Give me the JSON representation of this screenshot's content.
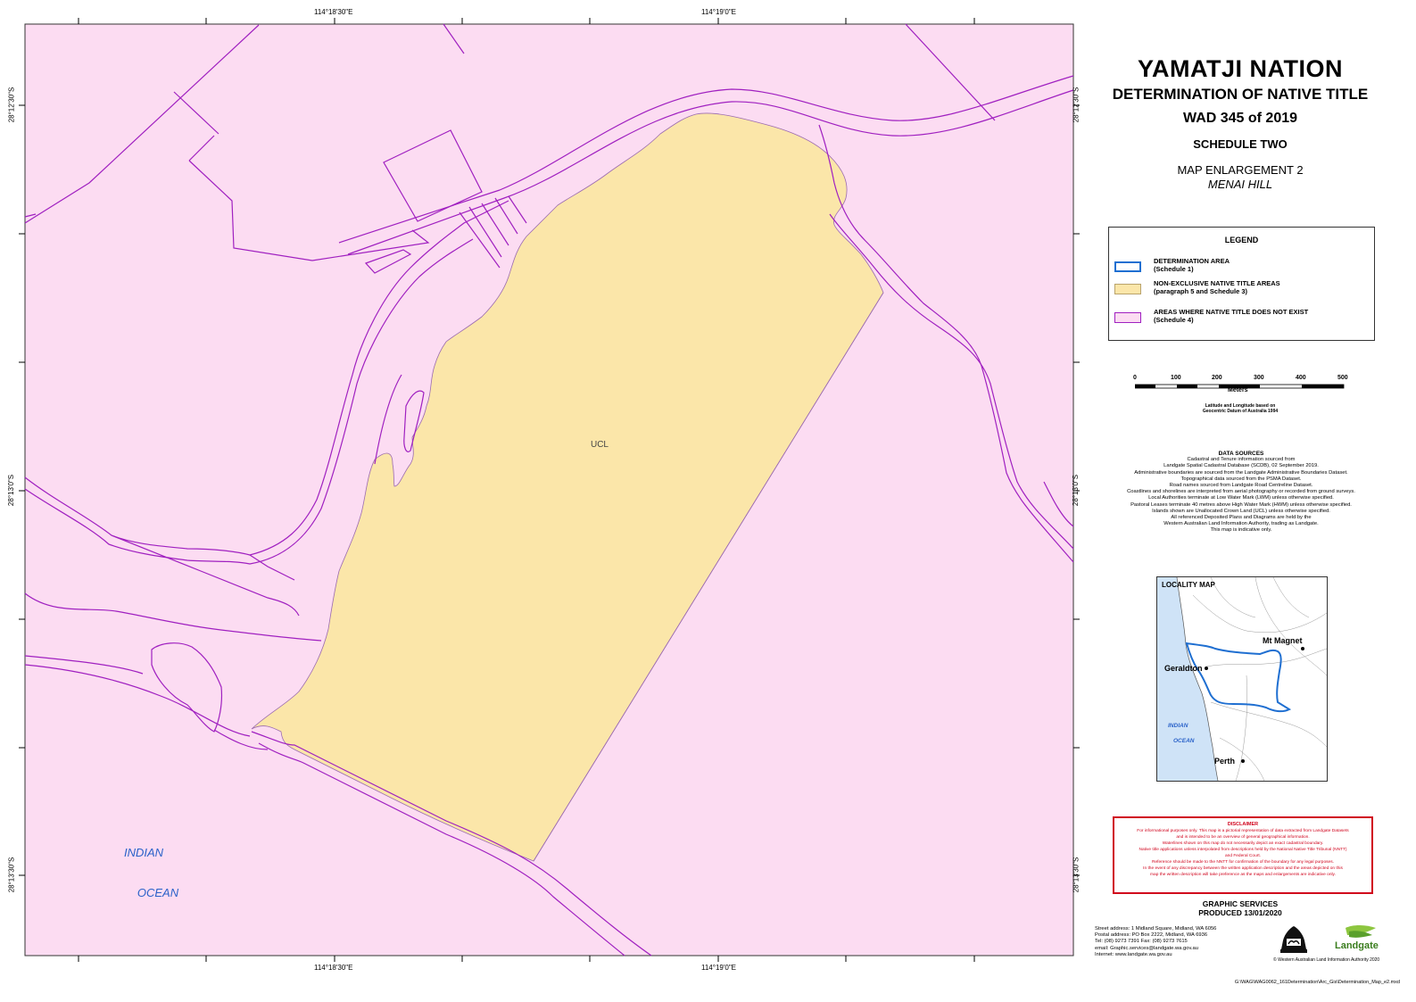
{
  "title": {
    "nation": "YAMATJI NATION",
    "determination": "DETERMINATION OF NATIVE TITLE",
    "case": "WAD 345 of 2019",
    "schedule": "SCHEDULE TWO",
    "enlargement": "MAP ENLARGEMENT 2",
    "place": "MENAI HILL"
  },
  "coordinates": {
    "top": [
      "114°18'30\"E",
      "114°19'0\"E"
    ],
    "bottom": [
      "114°18'30\"E",
      "114°19'0\"E"
    ],
    "left": [
      "28°12'30\"S",
      "28°13'0\"S",
      "28°13'30\"S"
    ],
    "right": [
      "28°12'30\"S",
      "28°13'0\"S",
      "28°13'30\"S"
    ]
  },
  "map_labels": {
    "ucl": "UCL",
    "ocean_1": "INDIAN",
    "ocean_2": "OCEAN"
  },
  "legend": {
    "title": "LEGEND",
    "items": [
      {
        "label": "DETERMINATION AREA",
        "sub": "(Schedule 1)",
        "color": "#1f6fd1"
      },
      {
        "label": "NON-EXCLUSIVE NATIVE TITLE AREAS",
        "sub": "(paragraph 5 and Schedule 3)",
        "color": "#fbe6a9"
      },
      {
        "label": "AREAS WHERE NATIVE TITLE DOES NOT EXIST",
        "sub": "(Schedule 4)",
        "color": "#fcdcf2"
      }
    ]
  },
  "scale": {
    "ticks": [
      "0",
      "100",
      "200",
      "300",
      "400",
      "500"
    ],
    "unit": "Meters"
  },
  "datum_note": [
    "Latitude and Longitude based on",
    "Geocentric Datum of Australia 1994"
  ],
  "data_sources": {
    "title": "DATA SOURCES",
    "lines": [
      "Cadastral and Tenure information sourced from",
      "Landgate Spatial Cadastral Database (SCDB), 02 September 2019.",
      "Administrative boundaries are sourced from the Landgate Administrative Boundaries Dataset.",
      "Topographical data sourced from the PSMA Dataset.",
      "Road names sourced from Landgate Road Centreline Dataset.",
      "Coastlines and shorelines are interpreted from aerial photography or recorded from ground surveys.",
      "Local Authorities terminate at Low Water Mark (LWM) unless otherwise specified.",
      "Pastoral Leases terminate 40 metres above High Water Mark (HWM) unless otherwise specified.",
      "Islands shown are Unallocated Crown Land (UCL) unless otherwise specified.",
      "All referenced Deposited Plans and Diagrams are held by the",
      "Western Australian Land Information Authority, trading as Landgate.",
      "This map is indicative only."
    ]
  },
  "locality_map": {
    "title": "LOCALITY MAP",
    "places": [
      "Mt Magnet",
      "Geraldton",
      "Perth"
    ],
    "ocean_1": "INDIAN",
    "ocean_2": "OCEAN"
  },
  "disclaimer": {
    "title": "DISCLAIMER",
    "lines": [
      "For informational purposes only. This map is a pictorial representation of data extracted from Landgate Datasets",
      "and is intended to be an overview of general geographical information.",
      "Waterlines shown on this map do not necessarily depict an exact cadastral boundary.",
      "Native title applications unless interpolated from descriptions held by the National Native Title Tribunal (NNTT)",
      "and Federal Court.",
      "Reference should be made to the NNTT for confirmation of the boundary for any legal purposes.",
      "In the event of any discrepancy between the written application description and the areas depicted on this",
      "map the written description will take preference as the maps and enlargements are indicative only."
    ]
  },
  "graphic_services": {
    "line1": "GRAPHIC SERVICES",
    "line2": "PRODUCED 13/01/2020"
  },
  "address": [
    "Street address: 1 Midland Square, Midland, WA 6056",
    "Postal address: PO Box 2222, Midland, WA 6936",
    "Tel: (08) 9273 7391   Fax: (08) 9273 7615",
    "email: Graphic.services@landgate.wa.gov.au",
    "Internet: www.landgate.wa.gov.au"
  ],
  "copyright": "© Western Australian Land Information Authority 2020",
  "file_path": "G:\\WAG\\WAG0062_161Determination\\Arc_Gis\\Determination_Map_e2.mxd",
  "logo_text": "Landgate"
}
